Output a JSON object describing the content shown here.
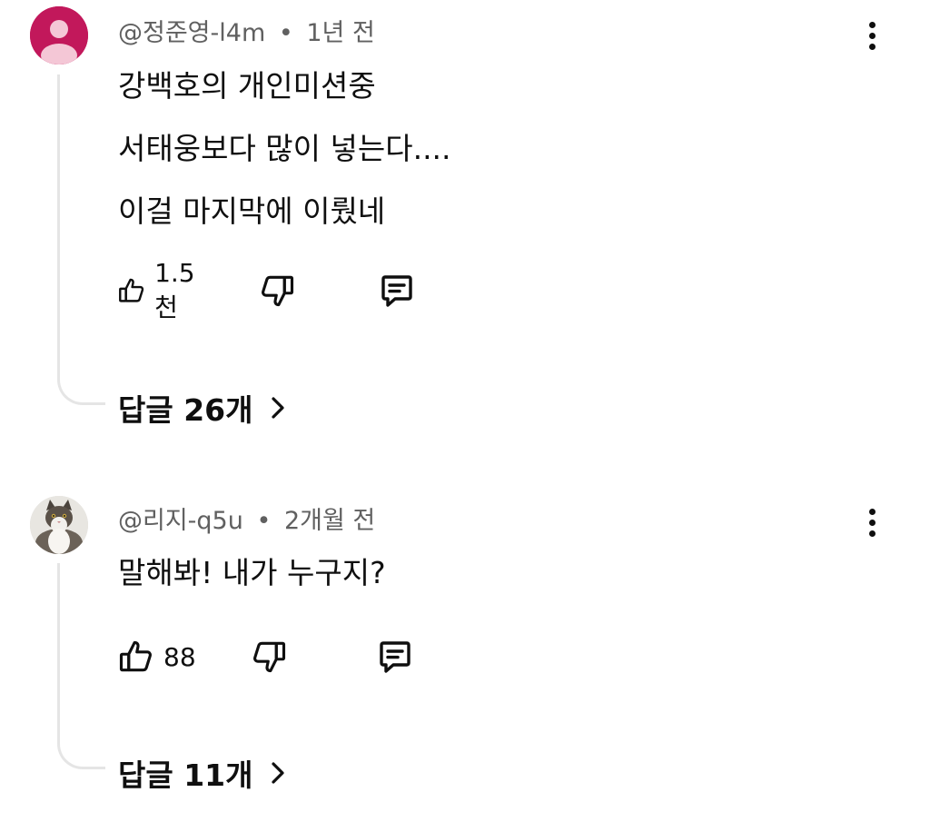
{
  "comments": [
    {
      "author": "@정준영-l4m",
      "separator": "•",
      "time": "1년 전",
      "lines": [
        "강백호의 개인미션중",
        "서태웅보다 많이 넣는다....",
        "이걸 마지막에 이뤘네"
      ],
      "likes": "1.5천",
      "replies_label": "답글 26개",
      "avatar_icon": "default-person-avatar",
      "avatar_color": "#c2185b"
    },
    {
      "author": "@리지-q5u",
      "separator": "•",
      "time": "2개월 전",
      "lines": [
        "말해봐! 내가 누구지?"
      ],
      "likes": "88",
      "replies_label": "답글 11개",
      "avatar_icon": "cat-photo-avatar"
    }
  ],
  "icons": {
    "like": "thumbs-up-icon",
    "dislike": "thumbs-down-icon",
    "reply": "comment-icon",
    "more": "more-vertical-icon",
    "expand": "chevron-right-icon"
  }
}
